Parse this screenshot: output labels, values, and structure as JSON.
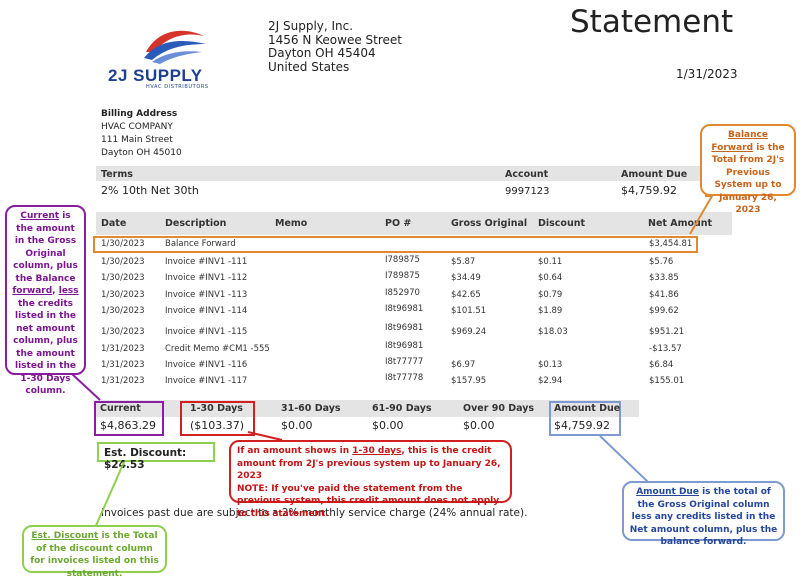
{
  "logo": {
    "name": "2J SUPPLY",
    "tagline": "HVAC DISTRIBUTORS"
  },
  "company": {
    "name": "2J Supply, Inc.",
    "street": "1456 N Keowee Street",
    "city": "Dayton OH 45404",
    "country": "United States"
  },
  "title": "Statement",
  "date": "1/31/2023",
  "billing": {
    "header": "Billing Address",
    "name": "HVAC COMPANY",
    "street": "111 Main Street",
    "city": "Dayton OH 45010"
  },
  "summary": {
    "terms_label": "Terms",
    "terms_value": "2% 10th Net 30th",
    "account_label": "Account",
    "account_value": "9997123",
    "amount_due_label": "Amount Due",
    "amount_due_value": "$4,759.92"
  },
  "table": {
    "headers": [
      "Date",
      "Description",
      "Memo",
      "PO #",
      "Gross Original",
      "Discount",
      "Net Amount"
    ],
    "rows": [
      {
        "date": "1/30/2023",
        "desc": "Balance Forward",
        "po": "",
        "gross": "",
        "disc": "",
        "net": "$3,454.81"
      },
      {
        "date": "1/30/2023",
        "desc": "Invoice #INV1 -111",
        "po": "I789875",
        "gross": "$5.87",
        "disc": "$0.11",
        "net": "$5.76"
      },
      {
        "date": "1/30/2023",
        "desc": "Invoice #INV1 -112",
        "po": "I789875",
        "gross": "$34.49",
        "disc": "$0.64",
        "net": "$33.85"
      },
      {
        "date": "1/30/2023",
        "desc": "Invoice #INV1 -113",
        "po": "I852970",
        "gross": "$42.65",
        "disc": "$0.79",
        "net": "$41.86"
      },
      {
        "date": "1/30/2023",
        "desc": "Invoice #INV1 -114",
        "po": "I8t96981",
        "gross": "$101.51",
        "disc": "$1.89",
        "net": "$99.62"
      },
      {
        "date": "1/30/2023",
        "desc": "Invoice #INV1 -115",
        "po": "I8t96981",
        "gross": "$969.24",
        "disc": "$18.03",
        "net": "$951.21"
      },
      {
        "date": "1/31/2023",
        "desc": "Credit Memo #CM1 -555",
        "po": "I8t96981",
        "gross": "",
        "disc": "",
        "net": "-$13.57"
      },
      {
        "date": "1/31/2023",
        "desc": "Invoice #INV1 -116",
        "po": "I8t77777",
        "gross": "$6.97",
        "disc": "$0.13",
        "net": "$6.84"
      },
      {
        "date": "1/31/2023",
        "desc": "Invoice #INV1 -117",
        "po": "I8t77778",
        "gross": "$157.95",
        "disc": "$2.94",
        "net": "$155.01"
      }
    ]
  },
  "aging": {
    "labels": [
      "Current",
      "1-30 Days",
      "31-60 Days",
      "61-90 Days",
      "Over 90 Days",
      "Amount Due"
    ],
    "values": [
      "$4,863.29",
      "($103.37)",
      "$0.00",
      "$0.00",
      "$0.00",
      "$4,759.92"
    ]
  },
  "est_discount": "Est. Discount: $24.53",
  "footer_note": "Invoices past due are subject to a 2% monthly service charge (24% annual rate).",
  "callouts": {
    "balance_forward": {
      "link": "Balance Forward",
      "text": " is the Total from 2J's Previous System up to January 26, 2023"
    },
    "current": {
      "link1": "Current",
      "text1": " is the amount in the Gross Original column, plus the Balance ",
      "link2": "forward",
      "text2": ", ",
      "link3": "less",
      "text3": " the credits listed in the net amount column, plus the amount listed in the 1-30 Days column."
    },
    "credit": {
      "pre": "If an amount shows in ",
      "link": "1-30 days",
      "post": ", this is the credit amount from 2J's previous system up to January 26, 2023",
      "note": "NOTE: If you've paid the statement from the previous system, this credit amount does not apply to this statement."
    },
    "amount_due": {
      "link": "Amount Due",
      "text": " is the total of the Gross Original column less any credits listed in the Net amount column, plus the balance forward."
    },
    "est_discount": {
      "link": "Est. Discount",
      "text": " is the Total of the discount column for invoices listed on this statement."
    }
  },
  "colors": {
    "brand_blue": "#1d3f8f",
    "brand_red": "#d6332b",
    "orange": "#e1892e",
    "purple": "#8a1ea0",
    "red": "#d21f1f",
    "blue": "#7d9bd0",
    "green": "#8fcf4f"
  }
}
